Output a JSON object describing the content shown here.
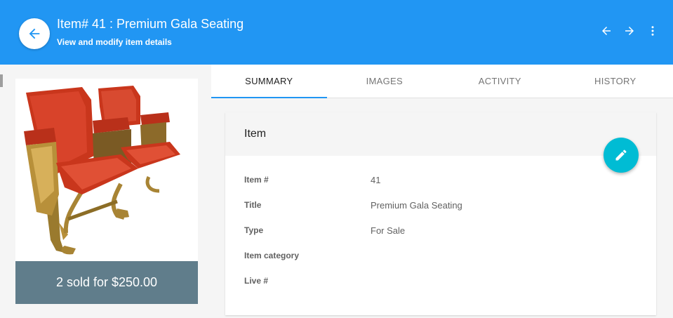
{
  "header": {
    "title": "Item# 41 : Premium Gala Seating",
    "subtitle": "View and modify item details",
    "back_icon": "arrow-left-icon",
    "prev_icon": "arrow-left-icon",
    "next_icon": "arrow-right-icon",
    "more_icon": "more-vertical-icon"
  },
  "image_panel": {
    "image": "theater-seats-image",
    "price_text": "2 sold for $250.00"
  },
  "tabs": [
    {
      "label": "SUMMARY",
      "active": true
    },
    {
      "label": "IMAGES",
      "active": false
    },
    {
      "label": "ACTIVITY",
      "active": false
    },
    {
      "label": "HISTORY",
      "active": false
    }
  ],
  "card": {
    "title": "Item",
    "edit_icon": "pencil-icon",
    "rows": [
      {
        "label": "Item #",
        "value": "41"
      },
      {
        "label": "Title",
        "value": "Premium Gala Seating"
      },
      {
        "label": "Type",
        "value": "For Sale"
      },
      {
        "label": "Item category",
        "value": ""
      },
      {
        "label": "Live #",
        "value": ""
      }
    ]
  },
  "colors": {
    "header": "#2196f3",
    "fab": "#00bcd4",
    "price_bar": "#607d8b",
    "tab_indicator": "#2196f3"
  }
}
